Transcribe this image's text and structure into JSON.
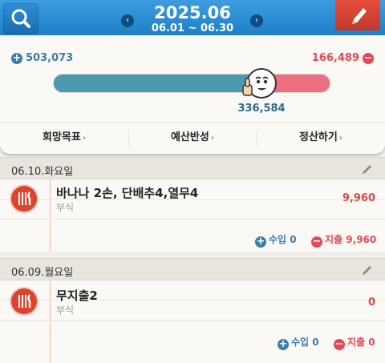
{
  "header": {
    "title": "2025.06",
    "subtitle": "06.01 ~ 06.30",
    "prev_arrow": "‹",
    "next_arrow": "›",
    "search_icon": "search-icon",
    "edit_icon": "pencil-icon",
    "colors": {
      "bar": "#2a88d2",
      "edit": "#d43a2f"
    }
  },
  "summary": {
    "income_sign": "+",
    "income": "503,073",
    "expense_sign": "−",
    "expense": "166,489",
    "balance": "336,584",
    "balance_fraction": 0.78,
    "links": [
      {
        "label": "희망목표",
        "arrow": "›"
      },
      {
        "label": "예산반성",
        "arrow": "›"
      },
      {
        "label": "정산하기",
        "arrow": "›"
      }
    ],
    "colors": {
      "income": "#3a7ea8",
      "expense": "#e24a55",
      "bar_income": "#4d99b0",
      "bar_expense": "#ee6f80"
    }
  },
  "days": [
    {
      "date": "06.10.화요일",
      "entries": [
        {
          "title": "바나나 2손, 단배추4,열무4",
          "category": "부식",
          "amount": "9,960",
          "icon": "fork-knife-icon"
        }
      ],
      "income_sign": "+",
      "income_label": "수입",
      "income": "0",
      "expense_sign": "−",
      "expense_label": "지출",
      "expense": "9,960"
    },
    {
      "date": "06.09.월요일",
      "entries": [
        {
          "title": "무지출2",
          "category": "부식",
          "amount": "0",
          "icon": "fork-knife-icon"
        }
      ],
      "income_sign": "+",
      "income_label": "수입",
      "income": "0",
      "expense_sign": "−",
      "expense_label": "지출",
      "expense": "0"
    }
  ]
}
